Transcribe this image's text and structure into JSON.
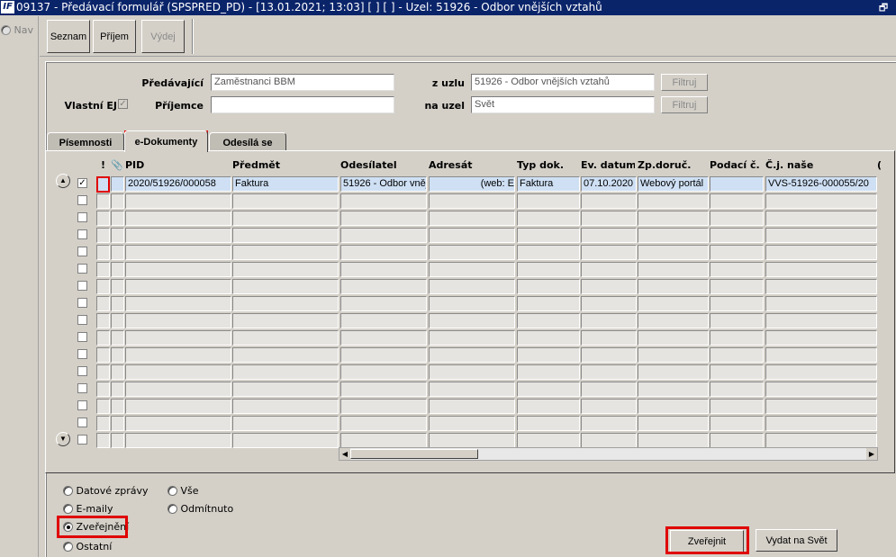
{
  "window": {
    "logo": "IF",
    "title": "09137 - Předávací formulář (SPSPRED_PD) - [13.01.2021; 13:03]  [ ]  [ ] - Uzel: 51926 - Odbor vnějších vztahů",
    "restore_glyph": "🗗"
  },
  "nav": {
    "label": "Nav"
  },
  "toolbar": {
    "seznam": "Seznam",
    "prijem": "Příjem",
    "vydej": "Výdej"
  },
  "form": {
    "predavajici_label": "Předávající",
    "predavajici_value": "Zaměstnanci BBM",
    "z_uzlu_label": "z uzlu",
    "z_uzlu_value": "51926 - Odbor vnějších vztahů",
    "filtr_label": "Filtruj",
    "vlastni_ej_label": "Vlastní EJ",
    "vlastni_ej_checked": "✓",
    "prijemce_label": "Příjemce",
    "prijemce_value": "",
    "na_uzel_label": "na uzel",
    "na_uzel_value": "Svět"
  },
  "tabs": {
    "pisemnosti": "Písemnosti",
    "edokumenty": "e-Dokumenty",
    "odesila_se": "Odesílá se"
  },
  "grid": {
    "headers": {
      "excl": "!",
      "attach": "📎",
      "pid": "PID",
      "predmet": "Předmět",
      "odesilatel": "Odesílatel",
      "adresat": "Adresát",
      "typ_dok": "Typ dok.",
      "ev_datum": "Ev. datum",
      "zp_doruc": "Zp.doruč.",
      "podaci_c": "Podací č.",
      "cj_nase": "Č.j. naše",
      "next": "("
    },
    "row1": {
      "checked": "✓",
      "pid": "2020/51926/000058",
      "predmet": "Faktura",
      "odesilatel": "51926 - Odbor vněj",
      "adresat": "(web: E",
      "typ_dok": "Faktura",
      "ev_datum": "07.10.2020",
      "zp_doruc": "Webový portál",
      "podaci_c": "",
      "cj_nase": "VVS-51926-000055/20"
    },
    "scroll_up": "▲",
    "scroll_down": "▼",
    "scroll_left": "◀",
    "scroll_right": "▶"
  },
  "filters": {
    "datove_zpravy": "Datové zprávy",
    "vse": "Vše",
    "emaily": "E-maily",
    "odmitnuto": "Odmítnuto",
    "zverejneni": "Zveřejnění",
    "ostatni": "Ostatní",
    "selected": "zverejneni"
  },
  "actions": {
    "zverejnit": "Zveřejnit",
    "vydat_na_svet": "Vydat na Svět"
  },
  "colors": {
    "title_bar": "#0a246a",
    "highlight": "#e00000",
    "selected_row": "#cfe0f4"
  }
}
